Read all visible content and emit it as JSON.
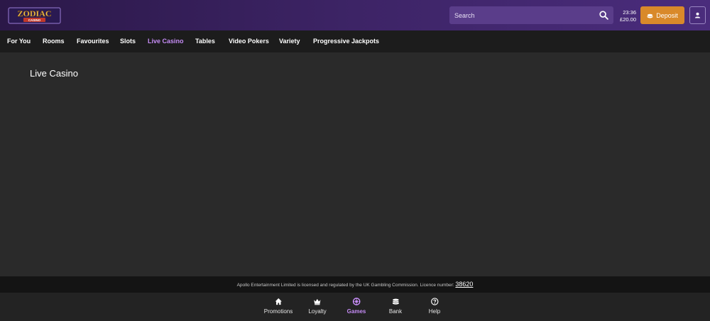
{
  "brand": {
    "logo_top": "ZODIAC",
    "logo_bottom": "CASINO"
  },
  "header": {
    "search_placeholder": "Search",
    "time": "23:36",
    "balance": "£20.00",
    "deposit_label": "Deposit"
  },
  "nav": {
    "items": [
      {
        "label": "For You"
      },
      {
        "label": "Rooms"
      },
      {
        "label": "Favourites"
      },
      {
        "label": "Slots"
      },
      {
        "label": "Live Casino"
      },
      {
        "label": "Tables"
      },
      {
        "label": "Video Pokers"
      },
      {
        "label": "Variety"
      },
      {
        "label": "Progressive Jackpots"
      }
    ],
    "active": "Live Casino"
  },
  "main": {
    "title": "Live Casino"
  },
  "footer": {
    "licence_text": "Apollo Entertainment Limited is licensed and regulated by the UK Gambling Commission. Licence number:",
    "licence_number": "38620"
  },
  "bottom_nav": {
    "items": [
      {
        "label": "Promotions",
        "icon": "home-icon"
      },
      {
        "label": "Loyalty",
        "icon": "crown-icon"
      },
      {
        "label": "Games",
        "icon": "games-icon"
      },
      {
        "label": "Bank",
        "icon": "bank-icon"
      },
      {
        "label": "Help",
        "icon": "help-icon"
      }
    ],
    "active": "Games"
  },
  "colors": {
    "header_purple": "#3d2466",
    "accent_purple": "#c58cf5",
    "deposit_orange": "#d9892a",
    "background": "#2a2a2a"
  }
}
